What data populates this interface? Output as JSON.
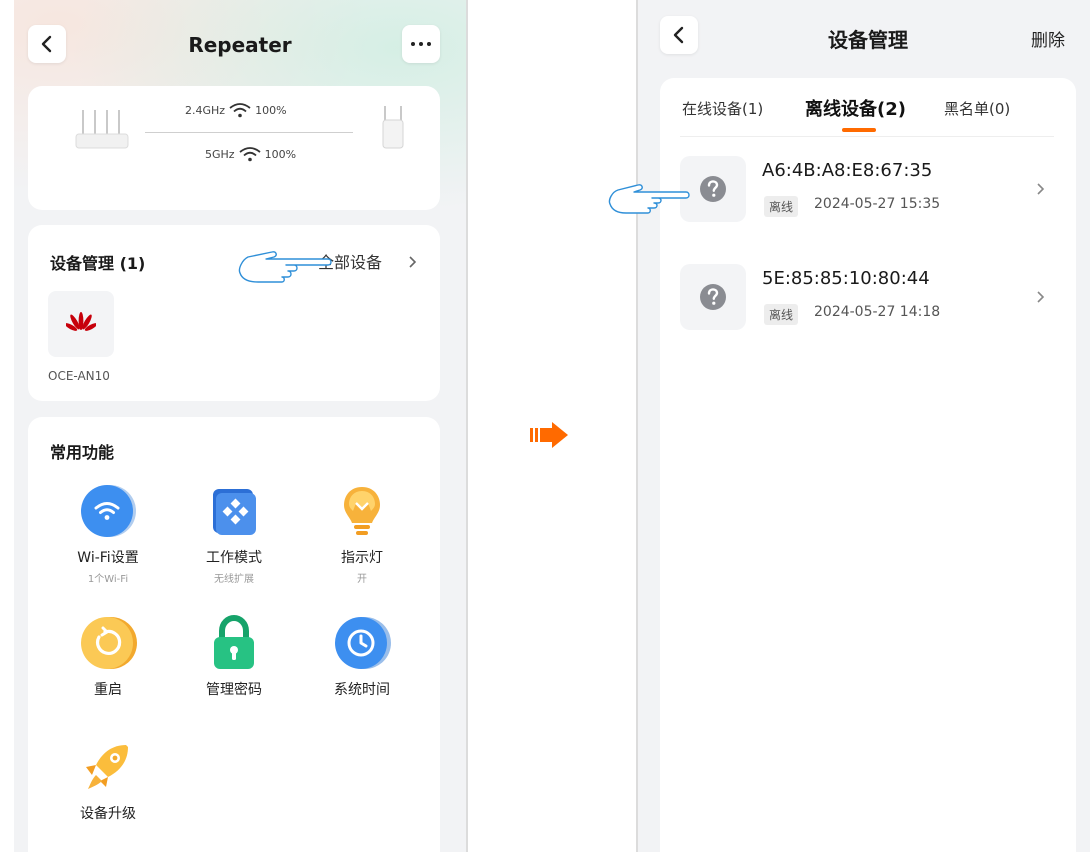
{
  "left_screen": {
    "header": {
      "title": "Repeater",
      "back_icon": "back-chevron-icon",
      "more_icon": "more-dots-icon"
    },
    "topology": {
      "band_24": "2.4GHz",
      "signal_24": "100%",
      "band_5": "5GHz",
      "signal_5": "100%",
      "router_icon": "router-icon",
      "repeater_icon": "repeater-icon",
      "wifi_icon": "wifi-icon"
    },
    "device_mgmt": {
      "title": "设备管理 (1)",
      "all_devices": "全部设备",
      "device": {
        "name": "OCE-AN10",
        "icon": "huawei-logo-icon",
        "brand_color": "#c7000b"
      }
    },
    "features": {
      "title": "常用功能",
      "items": [
        {
          "label": "Wi-Fi设置",
          "sub": "1个Wi-Fi",
          "icon": "wifi-settings-icon"
        },
        {
          "label": "工作模式",
          "sub": "无线扩展",
          "icon": "work-mode-icon"
        },
        {
          "label": "指示灯",
          "sub": "开",
          "icon": "bulb-icon"
        },
        {
          "label": "重启",
          "sub": "",
          "icon": "restart-icon"
        },
        {
          "label": "管理密码",
          "sub": "",
          "icon": "lock-icon"
        },
        {
          "label": "系统时间",
          "sub": "",
          "icon": "clock-icon"
        },
        {
          "label": "设备升级",
          "sub": "",
          "icon": "rocket-icon"
        }
      ]
    }
  },
  "right_screen": {
    "header": {
      "title": "设备管理",
      "action": "删除",
      "back_icon": "back-chevron-icon"
    },
    "tabs": [
      {
        "label": "在线设备(1)",
        "active": false
      },
      {
        "label": "离线设备(2)",
        "active": true
      },
      {
        "label": "黑名单(0)",
        "active": false
      }
    ],
    "devices": [
      {
        "mac": "A6:4B:A8:E8:67:35",
        "status": "离线",
        "time": "2024-05-27 15:35",
        "icon": "unknown-device-icon"
      },
      {
        "mac": "5E:85:85:10:80:44",
        "status": "离线",
        "time": "2024-05-27 14:18",
        "icon": "unknown-device-icon"
      }
    ]
  },
  "annotations": {
    "pointer_icon": "pointing-hand-icon",
    "arrow_icon": "next-step-arrow-icon"
  },
  "colors": {
    "accent": "#ff6a00",
    "pointer": "#2f8fd8",
    "huawei_red": "#c7000b"
  }
}
